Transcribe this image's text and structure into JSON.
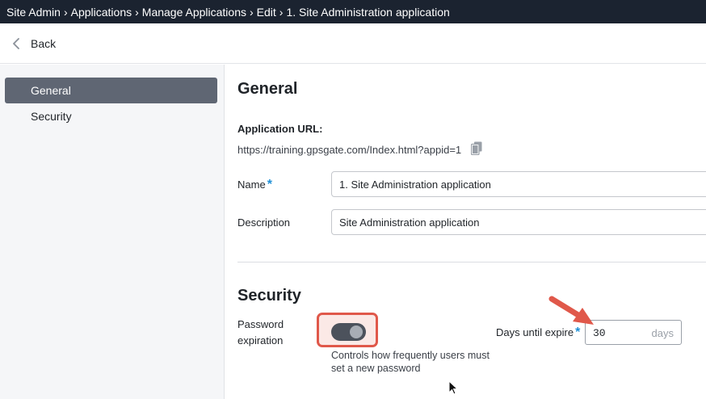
{
  "breadcrumb": {
    "items": [
      "Site Admin",
      "Applications",
      "Manage Applications",
      "Edit",
      "1. Site Administration application"
    ],
    "separator": "›"
  },
  "back": {
    "label": "Back"
  },
  "sidebar": {
    "items": [
      {
        "label": "General",
        "active": true
      },
      {
        "label": "Security",
        "active": false
      }
    ]
  },
  "general": {
    "title": "General",
    "url_label": "Application URL:",
    "url_value": "https://training.gpsgate.com/Index.html?appid=1",
    "name_label": "Name",
    "name_value": "1. Site Administration application",
    "description_label": "Description",
    "description_value": "Site Administration application",
    "required_marker": "*"
  },
  "security": {
    "title": "Security",
    "password_expiration_label": "Password expiration",
    "toggle_on": true,
    "help_text": "Controls how frequently users must set a new password",
    "days_label": "Days until expire",
    "days_value": "30",
    "days_unit": "days"
  },
  "colors": {
    "topbar_bg": "#1b2330",
    "sidebar_active": "#5f6673",
    "required": "#1e8fd6",
    "annotation": "#e0584a"
  },
  "icons": {
    "back": "chevron-left-icon",
    "copy": "copy-icon",
    "annotation_arrow": "arrow-icon",
    "cursor": "mouse-pointer-icon"
  }
}
